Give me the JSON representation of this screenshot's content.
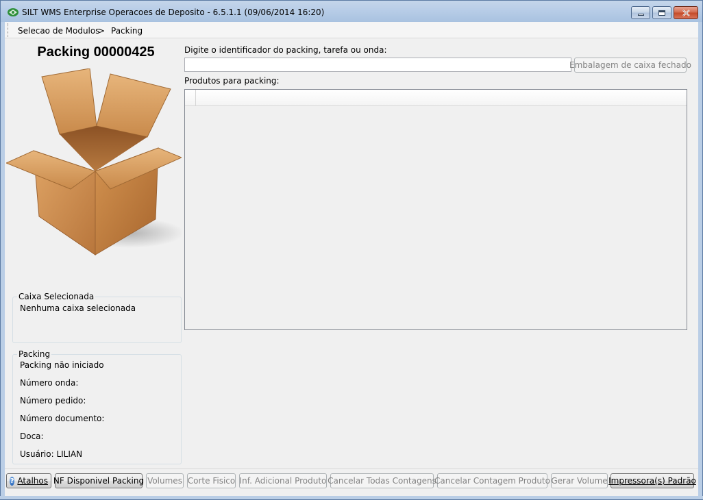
{
  "window": {
    "title": "SILT WMS Enterprise Operacoes de Deposito - 6.5.1.1 (09/06/2014 16:20)"
  },
  "breadcrumb": {
    "items": [
      "Selecao de Modulos",
      ">",
      "Packing"
    ]
  },
  "left_panel": {
    "title": "Packing 00000425",
    "box_image": "open-cardboard-box",
    "caixa": {
      "label": "Caixa Selecionada",
      "value": "Nenhuma caixa selecionada"
    },
    "packing": {
      "label": "Packing",
      "status": "Packing não iniciado",
      "numero_onda": "Número onda:",
      "numero_pedido": "Número pedido:",
      "numero_documento": "Número documento:",
      "doca": "Doca:",
      "usuario": "Usuário: LILIAN"
    }
  },
  "main": {
    "identifier_label": "Digite o identificador do packing, tarefa ou onda:",
    "identifier_value": "",
    "closed_box_button": "Embalagem de caixa fechado",
    "products_label": "Produtos para packing:"
  },
  "bottom_toolbar": {
    "atalhos": "Atalhos",
    "nf_disponivel": "NF Disponivel Packing",
    "volumes": "Volumes",
    "corte_fisico": "Corte Fisico",
    "inf_adicional": "Inf. Adicional Produto",
    "cancelar_todas": "Cancelar Todas Contagens",
    "cancelar_contagem": "Cancelar Contagem Produto",
    "gerar_volume": "Gerar Volume",
    "impressoras": "Impressora(s) Padrão"
  },
  "colors": {
    "titlebar": "#b9cee8",
    "background": "#f0f0f0",
    "box": "#c98a4b"
  }
}
